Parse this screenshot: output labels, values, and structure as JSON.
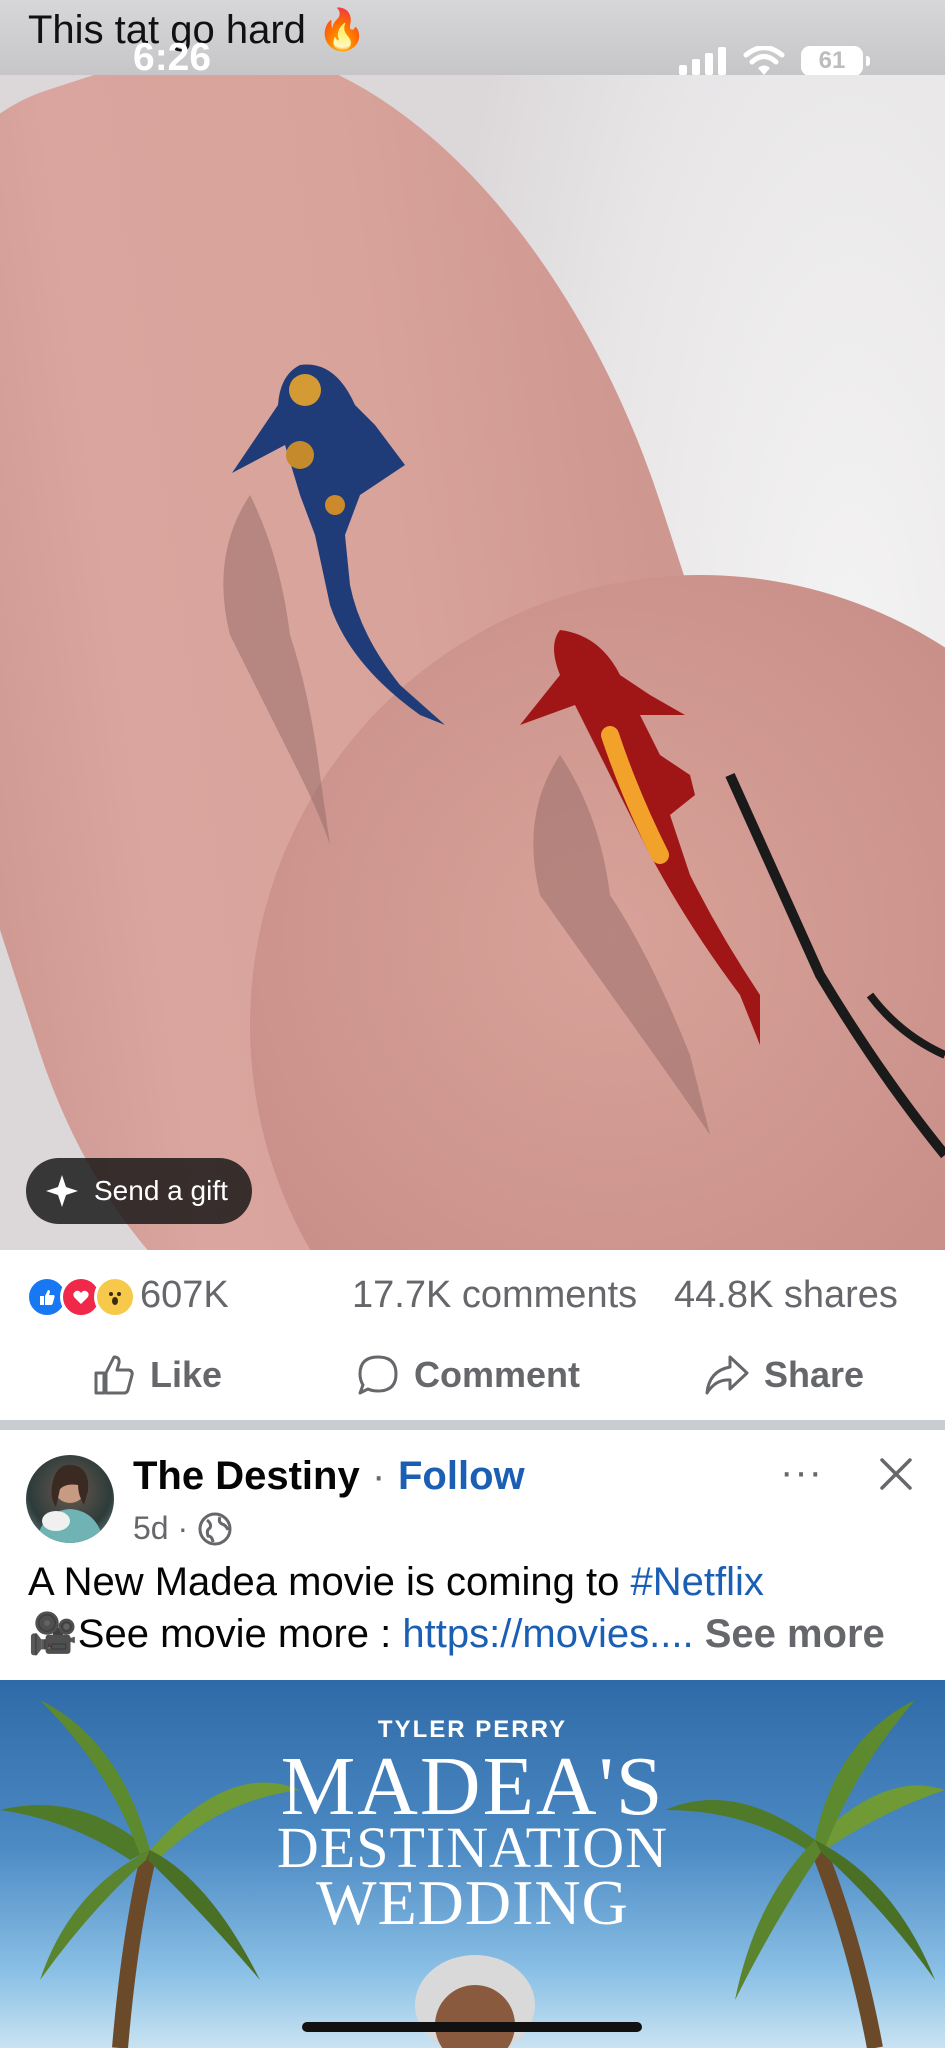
{
  "header": {
    "caption": "This tat go hard 🔥",
    "time": "6:26",
    "battery": "61"
  },
  "media": {
    "send_gift_label": "Send a gift"
  },
  "stats": {
    "reactions_count": "607K",
    "comments": "17.7K comments",
    "shares": "44.8K shares"
  },
  "actions": {
    "like": "Like",
    "comment": "Comment",
    "share": "Share"
  },
  "post2": {
    "author": "The Destiny",
    "separator": "·",
    "follow": "Follow",
    "time": "5d ·",
    "text_line1_prefix": "A New Madea movie is  coming to ",
    "hashtag": "#Netflix",
    "text_line2_prefix": "🎥See movie more : ",
    "link": "https://movies....",
    "see_more": " See more",
    "more_label": "···"
  },
  "poster": {
    "line1": "TYLER PERRY",
    "line2": "MADEA'S",
    "line3": "DESTINATION",
    "line4": "WEDDING"
  },
  "colors": {
    "link": "#1b5fb5",
    "muted": "#65676b",
    "like_blue": "#1877f2",
    "love_red": "#f02849"
  }
}
